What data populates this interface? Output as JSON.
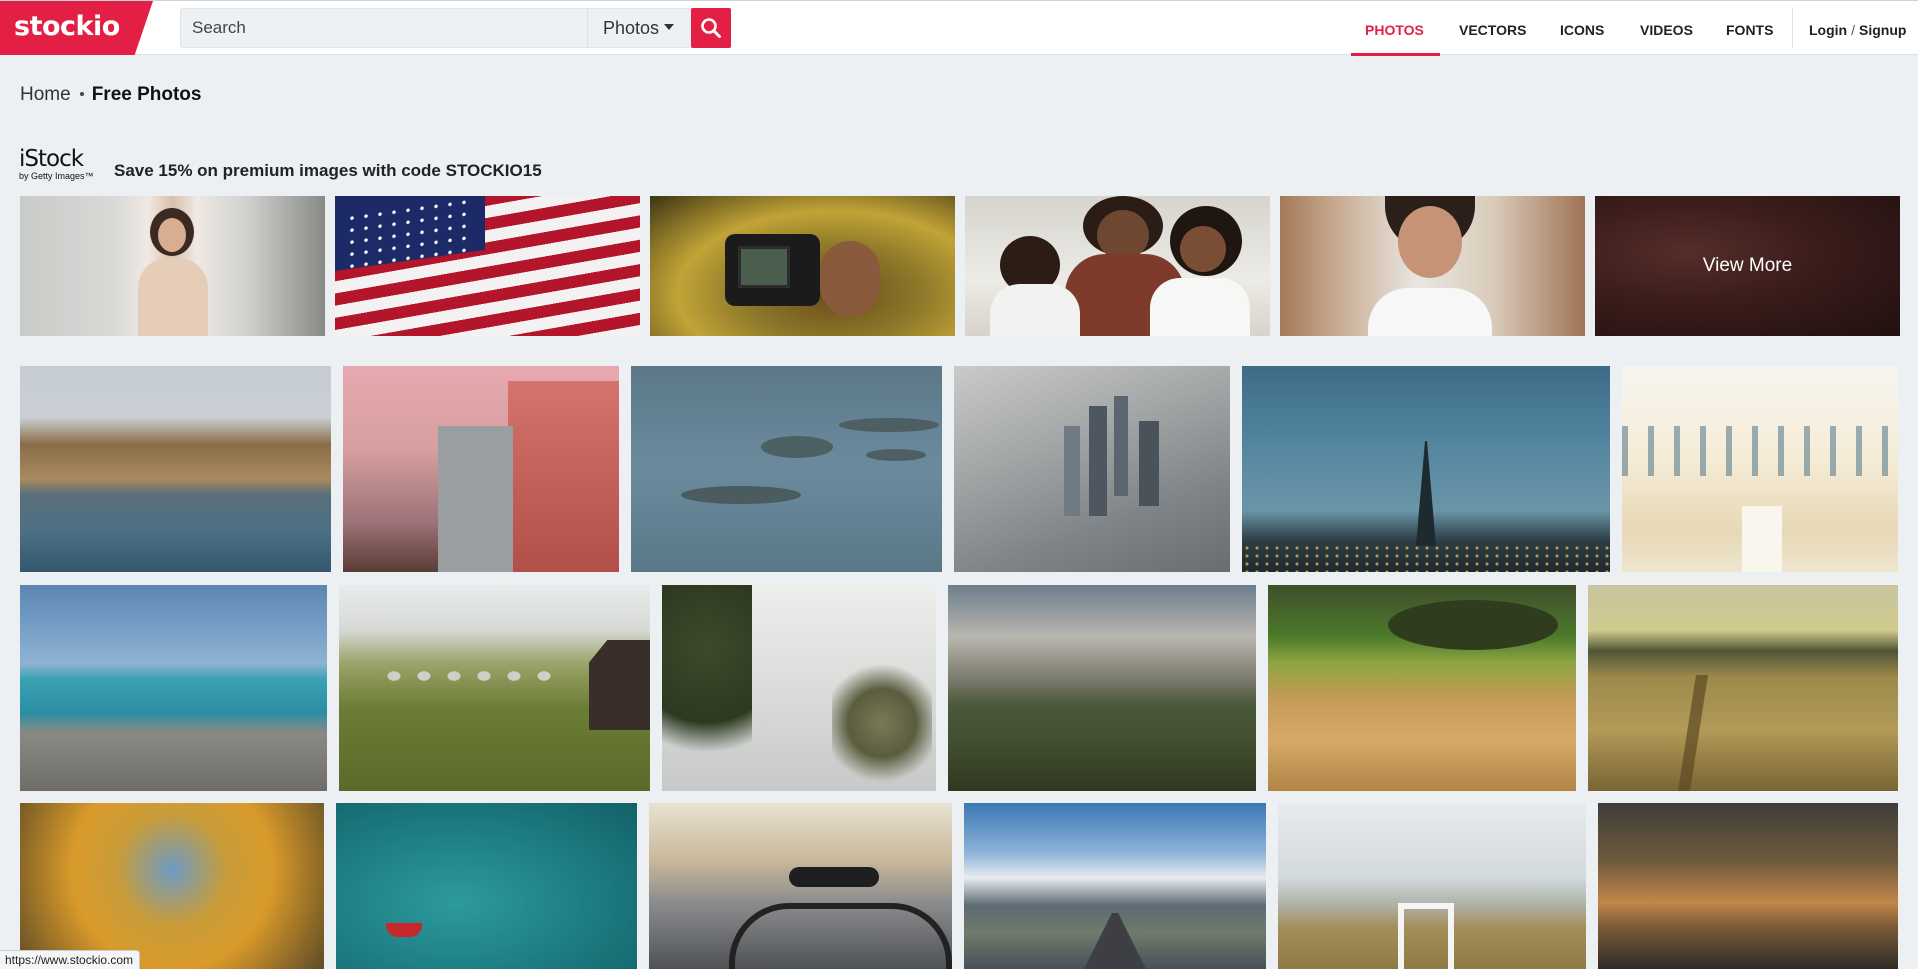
{
  "header": {
    "logo_text": "stockio",
    "search": {
      "placeholder": "Search",
      "value": ""
    },
    "type_select": {
      "selected": "Photos"
    },
    "nav": {
      "photos": "PHOTOS",
      "vectors": "VECTORS",
      "icons": "ICONS",
      "videos": "VIDEOS",
      "fonts": "FONTS"
    },
    "login": "Login",
    "login_separator": "/",
    "signup": "Signup",
    "accent_color": "#e31f45"
  },
  "breadcrumb": {
    "home": "Home",
    "current": "Free Photos"
  },
  "istock_banner": {
    "logo_text": "iStock",
    "logo_subtext": "by Getty Images™",
    "promo_text": "Save 15% on premium images with code STOCKIO15",
    "view_more_label": "View More",
    "photos": [
      "businesswoman portrait",
      "american flag",
      "camera in hands",
      "happy family",
      "woman portrait",
      "view more"
    ]
  },
  "gallery": {
    "rows": [
      [
        "rocky bay beach",
        "venice sign building",
        "lily pads on water",
        "aerial city skyline",
        "eiffel tower at dusk",
        "bright beach chairs"
      ],
      [
        "rocky coastline",
        "mountain village huts",
        "trees and sky",
        "valley under clouds",
        "wheat field",
        "meadow path"
      ],
      [
        "autumn treetops",
        "red boat on sea",
        "bicycle on street",
        "mountain road",
        "lifeguard chair on dunes",
        "sunset beach"
      ]
    ]
  },
  "status_bar": {
    "url": "https://www.stockio.com"
  }
}
